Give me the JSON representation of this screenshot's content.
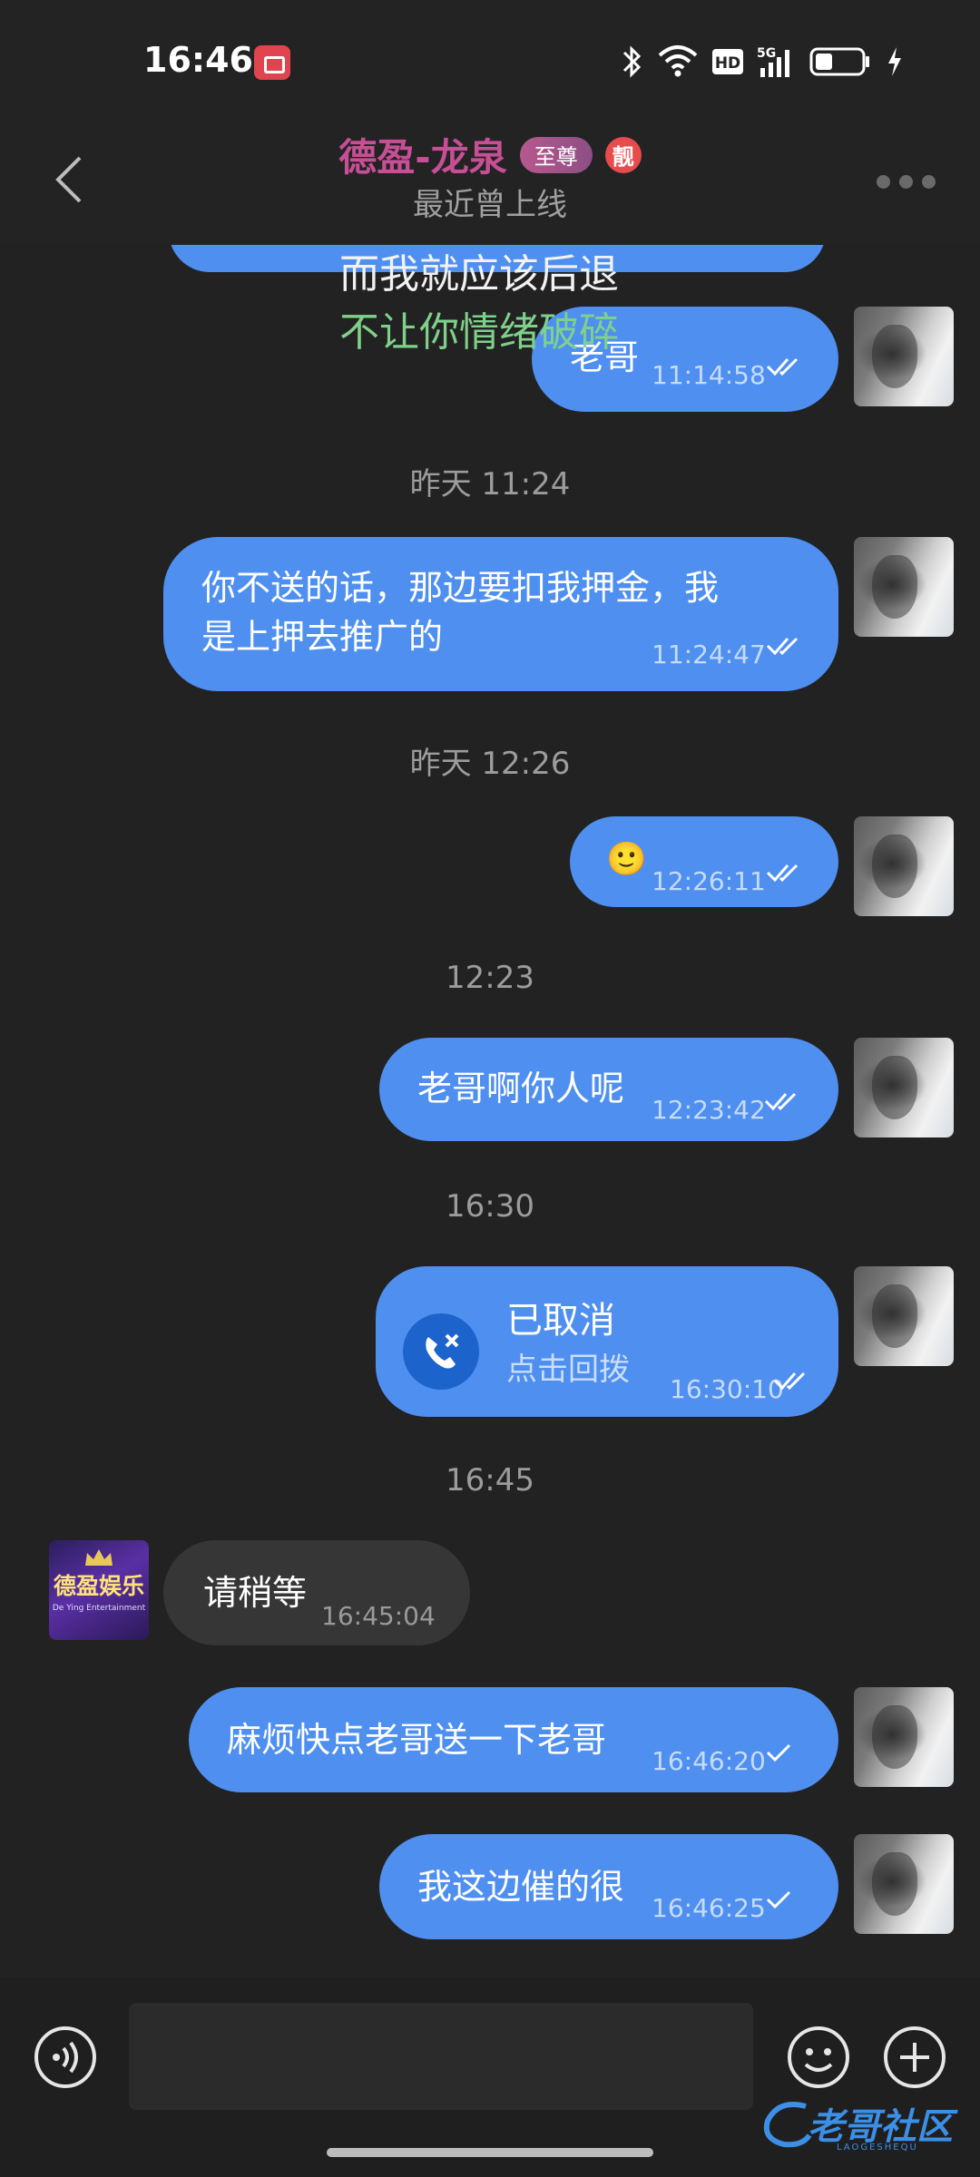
{
  "status_bar": {
    "time": "16:46",
    "network": "5G",
    "hd": "HD"
  },
  "header": {
    "contact_name": "德盈-龙泉",
    "vip_badge": "至尊",
    "liang_badge": "靓",
    "status": "最近曾上线"
  },
  "lyrics": {
    "line1": "而我就应该后退",
    "line2": "不让你情绪破碎"
  },
  "messages": [
    {
      "type": "out",
      "text": "老哥",
      "time": "11:14:58",
      "status": "read"
    },
    {
      "type": "time",
      "text": "昨天 11:24"
    },
    {
      "type": "out",
      "text": "你不送的话，那边要扣我押金，我是上押去推广的",
      "line1": "你不送的话，那边要扣我押金，我",
      "line2": "是上押去推广的",
      "time": "11:24:47",
      "status": "read"
    },
    {
      "type": "time",
      "text": "昨天 12:26"
    },
    {
      "type": "out",
      "text": "🙂",
      "time": "12:26:11",
      "status": "read"
    },
    {
      "type": "time",
      "text": "12:23"
    },
    {
      "type": "out",
      "text": "老哥啊你人呢",
      "time": "12:23:42",
      "status": "read"
    },
    {
      "type": "time",
      "text": "16:30"
    },
    {
      "type": "call",
      "title": "已取消",
      "subtitle": "点击回拨",
      "time": "16:30:10",
      "status": "read"
    },
    {
      "type": "time",
      "text": "16:45"
    },
    {
      "type": "in",
      "text": "请稍等",
      "time": "16:45:04"
    },
    {
      "type": "out",
      "text": "麻烦快点老哥送一下老哥",
      "time": "16:46:20",
      "status": "sent"
    },
    {
      "type": "out",
      "text": "我这边催的很",
      "time": "16:46:25",
      "status": "sent"
    }
  ],
  "other_avatar": {
    "logo_text": "德盈娱乐",
    "logo_sub": "De Ying Entertainment"
  },
  "input": {
    "placeholder": "",
    "value": ""
  },
  "watermark": {
    "text": "老哥社区",
    "sub": "LAOGESHEQU"
  },
  "colors": {
    "outgoing_bubble": "#4e8ff0",
    "incoming_bubble": "#363636",
    "background": "#222222",
    "contact_name": "#c64f95",
    "lyric_highlight": "#7fd18a"
  },
  "icons": {
    "back": "chevron-left-icon",
    "more": "more-dots-icon",
    "voice": "voice-icon",
    "emoji": "smiley-icon",
    "plus": "plus-icon",
    "call": "missed-call-icon",
    "read": "double-check-icon",
    "sent": "check-icon"
  }
}
